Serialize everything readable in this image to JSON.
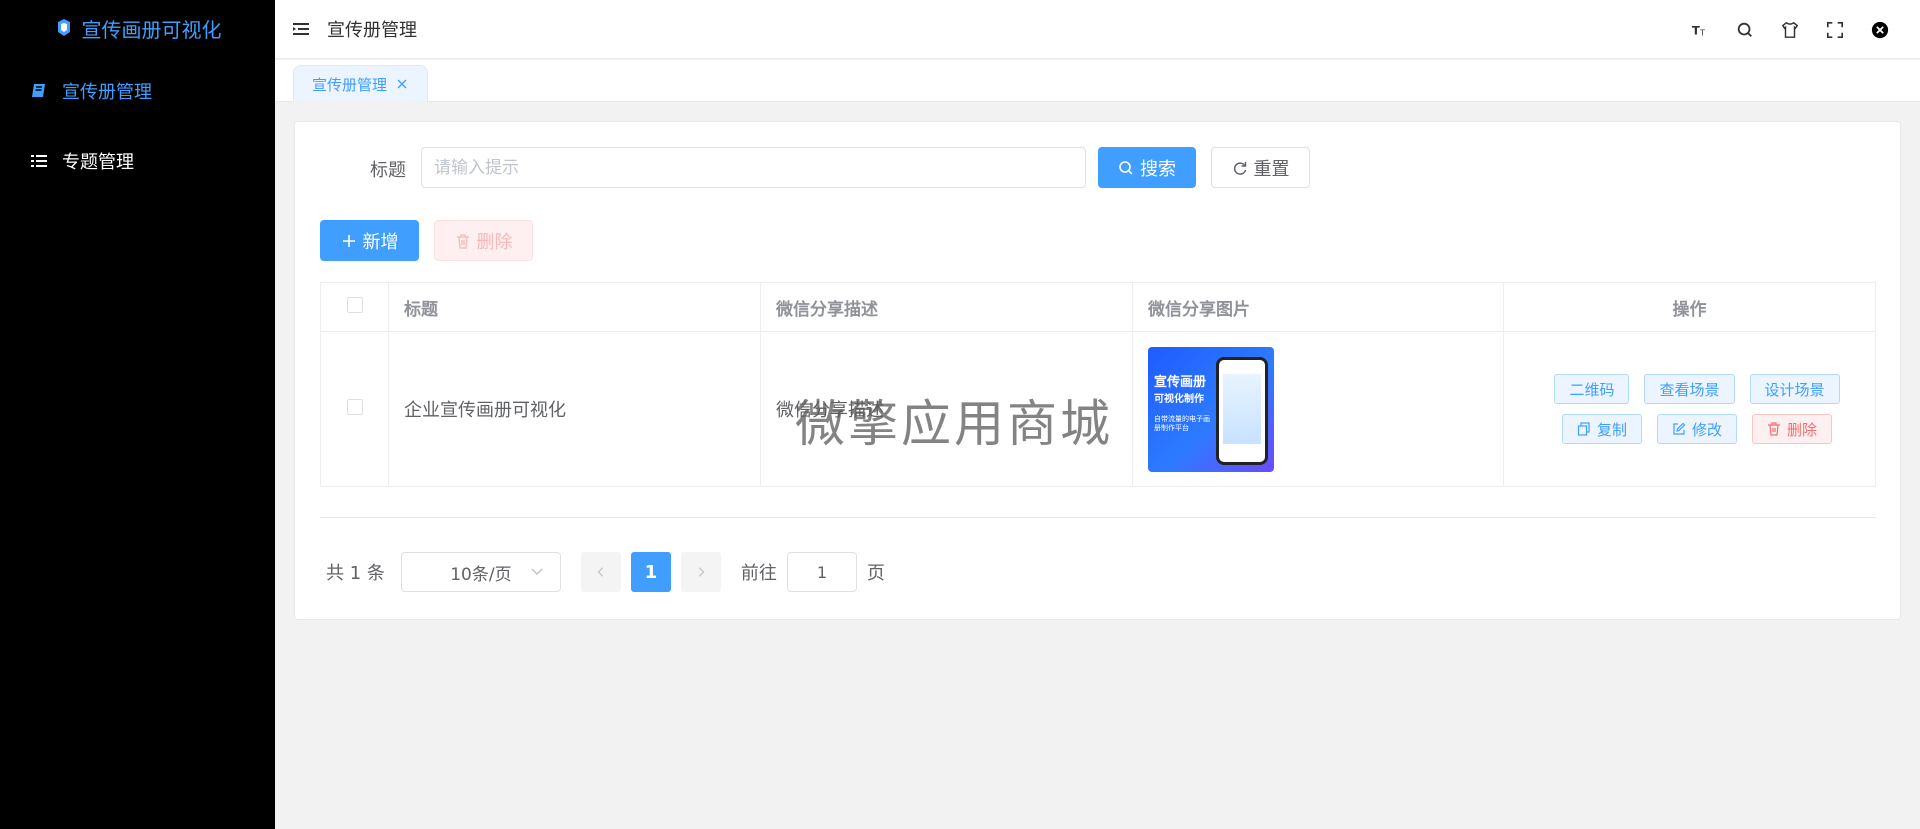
{
  "sidebar": {
    "logo_text": "宣传画册可视化",
    "items": [
      {
        "label": "宣传册管理",
        "icon": "book-icon",
        "active": true
      },
      {
        "label": "专题管理",
        "icon": "list-icon",
        "active": false
      }
    ]
  },
  "header": {
    "title": "宣传册管理",
    "tools": [
      "font-size-icon",
      "search-icon",
      "theme-shirt-icon",
      "fullscreen-icon",
      "close-circle-icon"
    ]
  },
  "tabs": [
    {
      "label": "宣传册管理"
    }
  ],
  "search": {
    "label": "标题",
    "placeholder": "请输入提示",
    "search_label": "搜索",
    "reset_label": "重置"
  },
  "toolbar": {
    "add_label": "新增",
    "delete_label": "删除"
  },
  "table": {
    "headers": [
      "标题",
      "微信分享描述",
      "微信分享图片",
      "操作"
    ],
    "rows": [
      {
        "title": "企业宣传画册可视化",
        "description": "微信分享描述",
        "image": {
          "line1": "宣传画册",
          "line2": "可视化制作",
          "line3": "自带流量的电子画册制作平台"
        },
        "actions": {
          "qrcode": "二维码",
          "view": "查看场景",
          "design": "设计场景",
          "copy": "复制",
          "edit": "修改",
          "delete": "删除"
        }
      }
    ]
  },
  "watermark": "微擎应用商城",
  "pagination": {
    "total_text": "共 1 条",
    "page_size": "10条/页",
    "current_page": "1",
    "goto_label": "前往",
    "goto_value": "1",
    "page_suffix": "页"
  },
  "colors": {
    "primary": "#409eff",
    "danger": "#f56c6c",
    "sidebar_bg": "#000000"
  }
}
